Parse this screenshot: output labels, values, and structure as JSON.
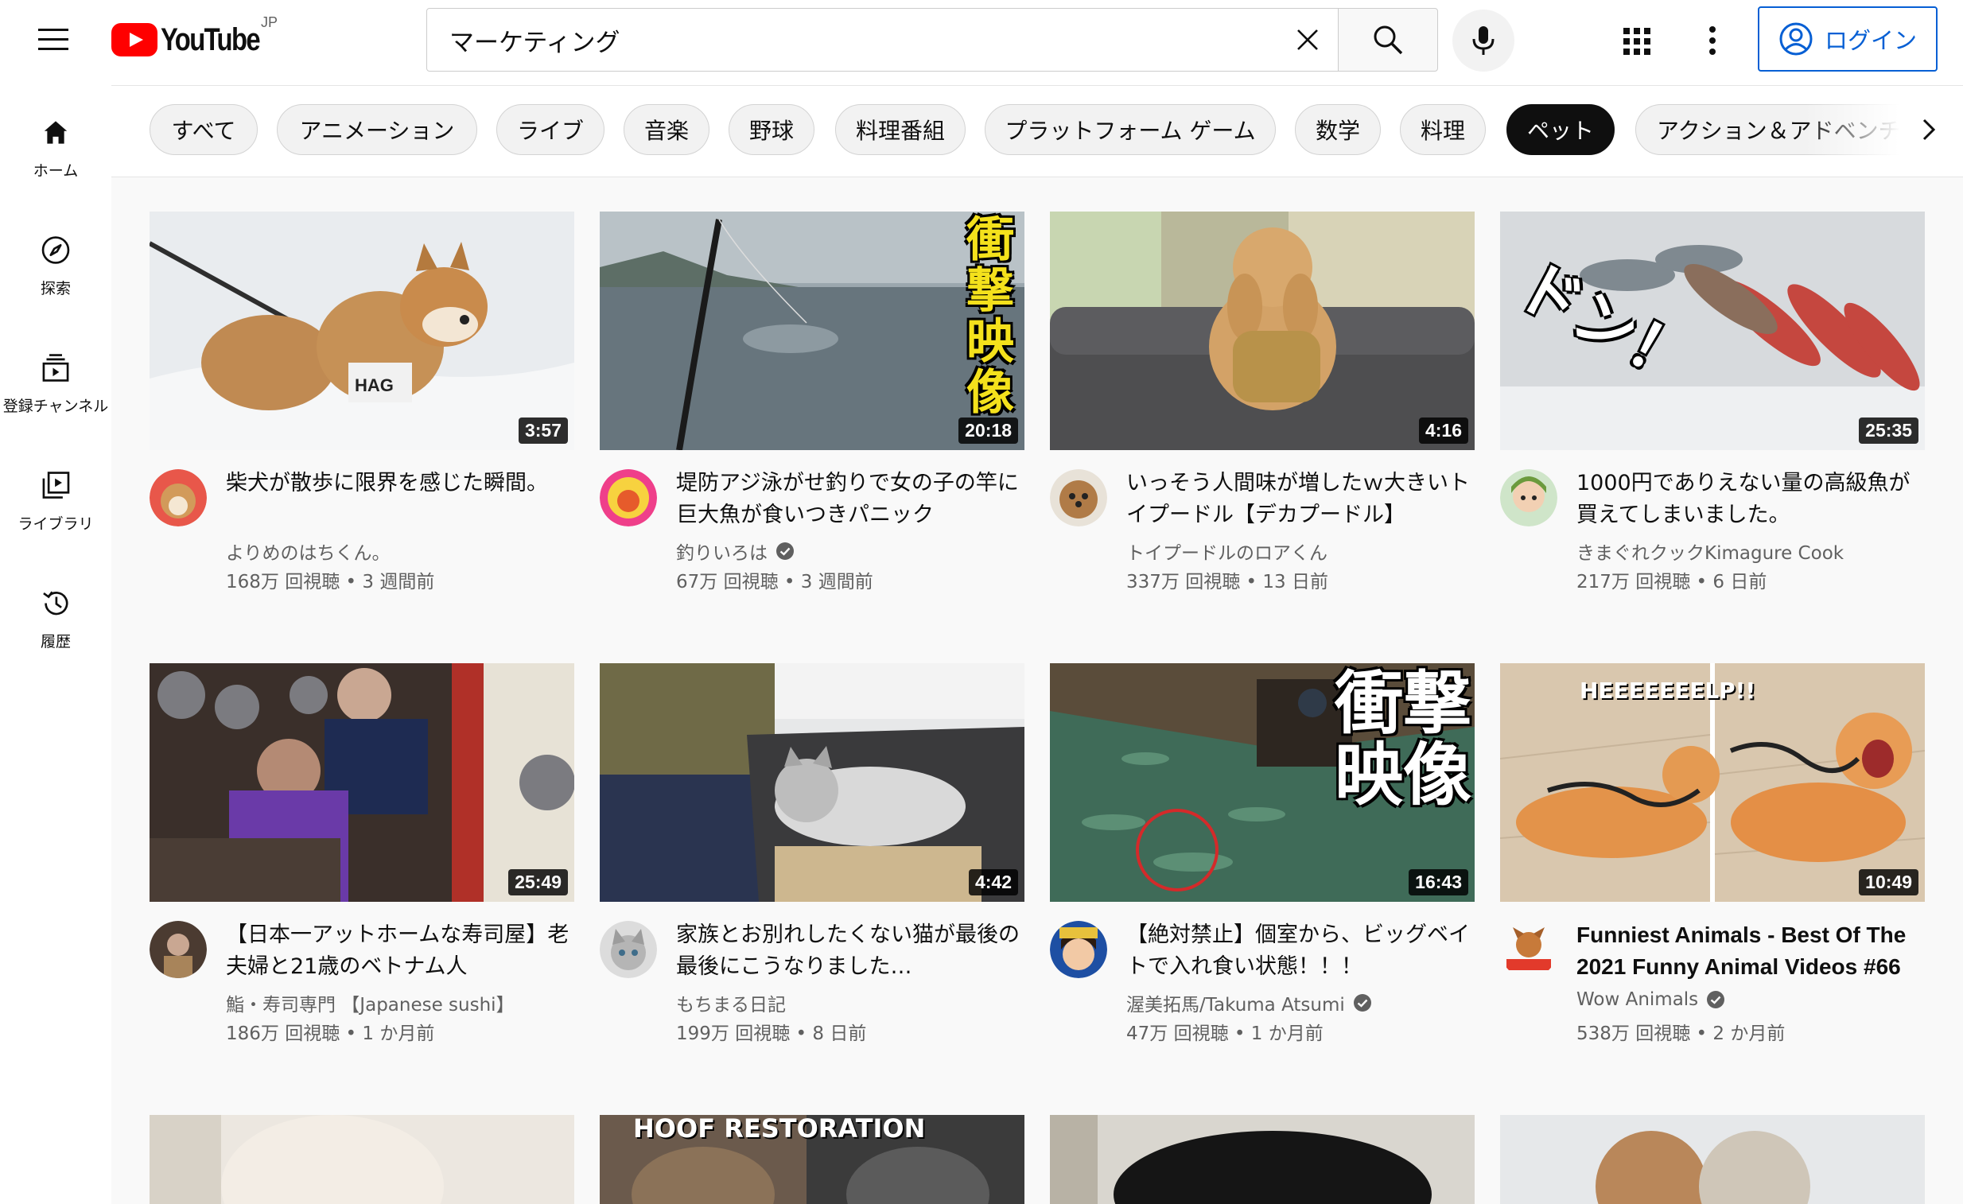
{
  "header": {
    "logo_text": "YouTube",
    "region": "JP",
    "search_value": "マーケティング",
    "login_label": "ログイン"
  },
  "sidebar": {
    "items": [
      {
        "label": "ホーム",
        "icon": "home-icon"
      },
      {
        "label": "探索",
        "icon": "compass-icon"
      },
      {
        "label": "登録チャンネル",
        "icon": "subscriptions-icon"
      },
      {
        "label": "ライブラリ",
        "icon": "library-icon"
      },
      {
        "label": "履歴",
        "icon": "history-icon"
      }
    ]
  },
  "chips": [
    {
      "label": "すべて",
      "active": false
    },
    {
      "label": "アニメーション",
      "active": false
    },
    {
      "label": "ライブ",
      "active": false
    },
    {
      "label": "音楽",
      "active": false
    },
    {
      "label": "野球",
      "active": false
    },
    {
      "label": "料理番組",
      "active": false
    },
    {
      "label": "プラットフォーム ゲーム",
      "active": false
    },
    {
      "label": "数学",
      "active": false
    },
    {
      "label": "料理",
      "active": false
    },
    {
      "label": "ペット",
      "active": true
    },
    {
      "label": "アクション＆アドベンチャー",
      "active": false
    }
  ],
  "videos": [
    {
      "title": "柴犬が散歩に限界を感じた瞬間。",
      "channel": "よりめのはちくん。",
      "verified": false,
      "views": "168万 回視聴",
      "age": "3 週間前",
      "duration": "3:57"
    },
    {
      "title": "堤防アジ泳がせ釣りで女の子の竿に巨大魚が食いつきパニック",
      "channel": "釣りいろは",
      "verified": true,
      "views": "67万 回視聴",
      "age": "3 週間前",
      "duration": "20:18",
      "overlay": "衝撃映像"
    },
    {
      "title": "いっそう人間味が増したｗ大きいトイプードル【デカプードル】",
      "channel": "トイプードルのロアくん",
      "verified": false,
      "views": "337万 回視聴",
      "age": "13 日前",
      "duration": "4:16"
    },
    {
      "title": "1000円でありえない量の高級魚が買えてしまいました。",
      "channel": "きまぐれクックKimagure Cook",
      "verified": false,
      "views": "217万 回視聴",
      "age": "6 日前",
      "duration": "25:35",
      "overlay": "ドン！"
    },
    {
      "title": "【日本一アットホームな寿司屋】老夫婦と21歳のベトナム人",
      "channel": "鮨・寿司専門 【Japanese sushi】",
      "verified": false,
      "views": "186万 回視聴",
      "age": "1 か月前",
      "duration": "25:49"
    },
    {
      "title": "家族とお別れしたくない猫が最後の最後にこうなりました…",
      "channel": "もちまる日記",
      "verified": false,
      "views": "199万 回視聴",
      "age": "8 日前",
      "duration": "4:42"
    },
    {
      "title": "【絶対禁止】個室から、ビッグベイトで入れ食い状態！！！",
      "channel": "渥美拓馬/Takuma Atsumi",
      "verified": true,
      "views": "47万 回視聴",
      "age": "1 か月前",
      "duration": "16:43",
      "overlay": "衝撃映像"
    },
    {
      "title": "Funniest Animals - Best Of The 2021 Funny Animal Videos #66",
      "channel": "Wow Animals",
      "verified": true,
      "views": "538万 回視聴",
      "age": "2 か月前",
      "duration": "10:49",
      "overlay": "HEEEEEEELP!!"
    },
    {
      "overlay": "HOOF RESTORATION"
    }
  ],
  "colors": {
    "brand_red": "#ff0000",
    "link_blue": "#065fd4",
    "text_secondary": "#606060"
  }
}
